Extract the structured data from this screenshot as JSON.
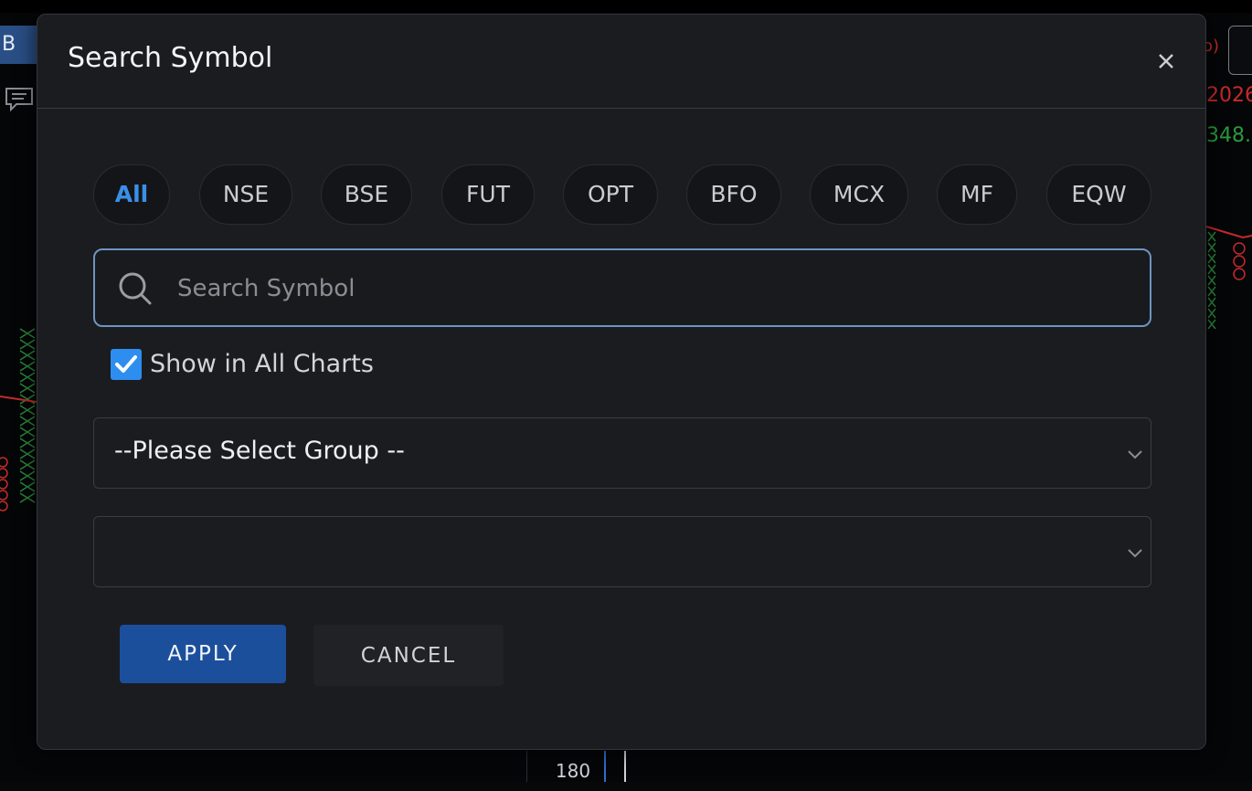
{
  "background": {
    "tab_label": "B",
    "right_label_1": "o)",
    "right_value_red": "2026",
    "right_value_green": "348.",
    "axis_label": "180"
  },
  "modal": {
    "title": "Search Symbol",
    "exchange_filters": [
      "All",
      "NSE",
      "BSE",
      "FUT",
      "OPT",
      "BFO",
      "MCX",
      "MF",
      "EQW"
    ],
    "active_filter": "All",
    "search": {
      "placeholder": "Search Symbol",
      "value": ""
    },
    "show_in_all_charts": {
      "label": "Show in All Charts",
      "checked": true
    },
    "group_select": {
      "value": "--Please Select Group --"
    },
    "second_select": {
      "value": ""
    },
    "apply_label": "APPLY",
    "cancel_label": "CANCEL"
  },
  "colors": {
    "accent": "#2d8ef0",
    "apply_button": "#1b4f9c",
    "active_chip_text": "#3b8fe8",
    "modal_bg": "#1b1c20"
  }
}
